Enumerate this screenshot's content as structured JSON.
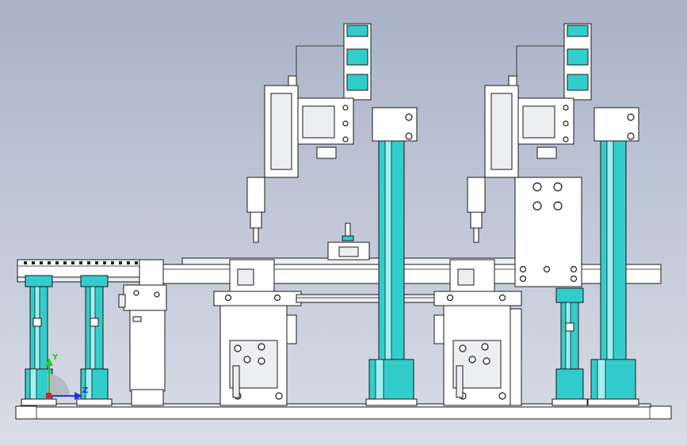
{
  "viewport": {
    "background_top": "#a9b2c7",
    "background_bottom": "#d9dde7",
    "part_fill": "#ffffff",
    "column_color": "#33cccc",
    "edge_color": "#1a1a1a"
  },
  "triad": {
    "y_label": "Y",
    "z_label": "Z",
    "y_color": "#22cc22",
    "z_color": "#2233dd",
    "x_color": "#dd2222"
  }
}
